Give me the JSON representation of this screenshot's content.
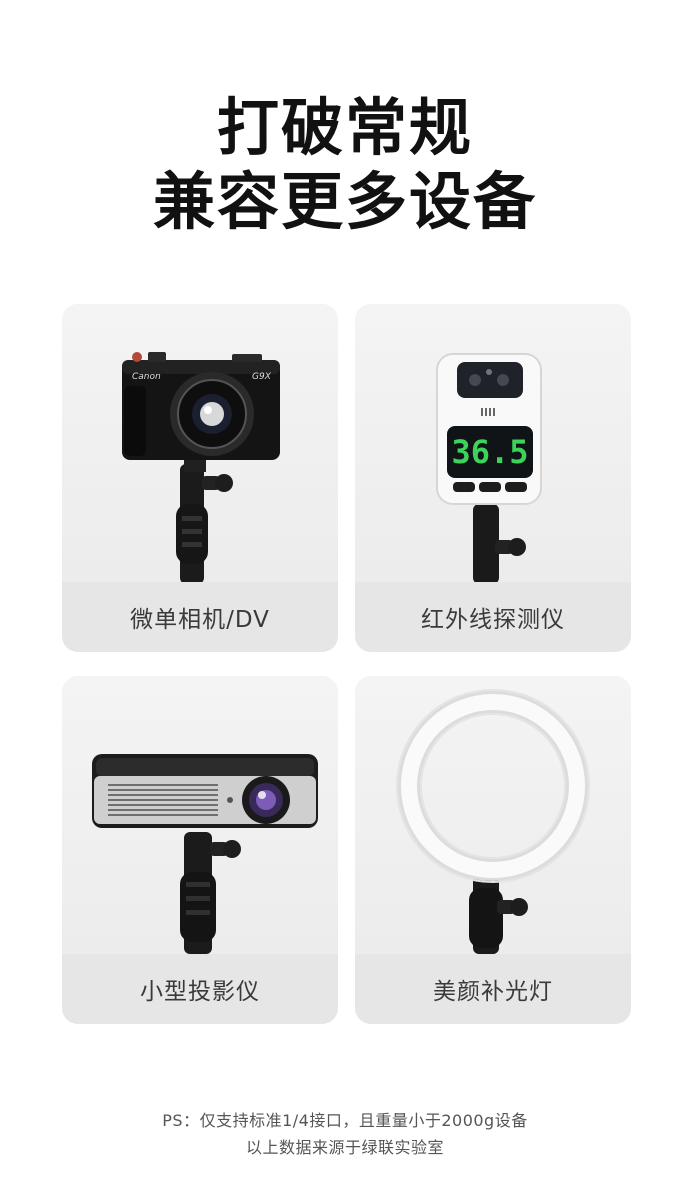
{
  "headline": {
    "line1": "打破常规",
    "line2": "兼容更多设备"
  },
  "devices": [
    {
      "label": "微单相机/DV",
      "icon": "camera-icon",
      "brand_text": "Canon",
      "model_text": "G9X"
    },
    {
      "label": "红外线探测仪",
      "icon": "thermometer-icon",
      "display_value": "36.5"
    },
    {
      "label": "小型投影仪",
      "icon": "projector-icon"
    },
    {
      "label": "美颜补光灯",
      "icon": "ring-light-icon"
    }
  ],
  "footnote": {
    "line1": "PS：仅支持标准1/4接口，且重量小于2000g设备",
    "line2": "以上数据来源于绿联实验室"
  },
  "colors": {
    "background": "#ffffff",
    "card_bg": "#f1f1f1",
    "label_bar": "#e6e6e6",
    "display_green": "#3bd35a"
  }
}
